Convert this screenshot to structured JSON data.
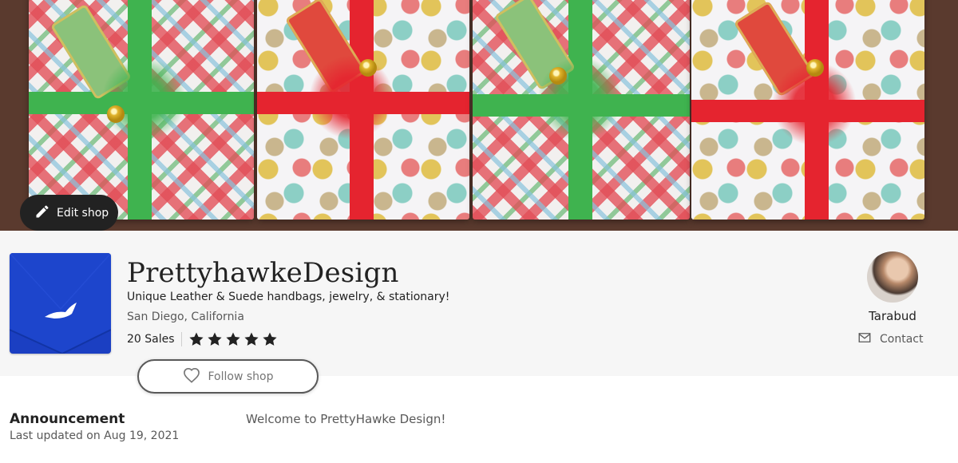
{
  "banner": {
    "edit_shop_label": "Edit shop"
  },
  "shop": {
    "name": "PrettyhawkeDesign",
    "tagline": "Unique Leather & Suede handbags, jewelry, & stationary!",
    "location": "San Diego, California",
    "sales": "20 Sales",
    "rating": 5,
    "rating_max": 5,
    "follow_label": "Follow shop"
  },
  "owner": {
    "name": "Tarabud",
    "contact_label": "Contact"
  },
  "announcement": {
    "title": "Announcement",
    "updated": "Last updated on Aug 19, 2021",
    "text": "Welcome to PrettyHawke Design!"
  },
  "colors": {
    "dark": "#222222",
    "muted": "#595959",
    "header_bg": "#f6f6f6",
    "logo_blue": "#1b3fc2"
  }
}
